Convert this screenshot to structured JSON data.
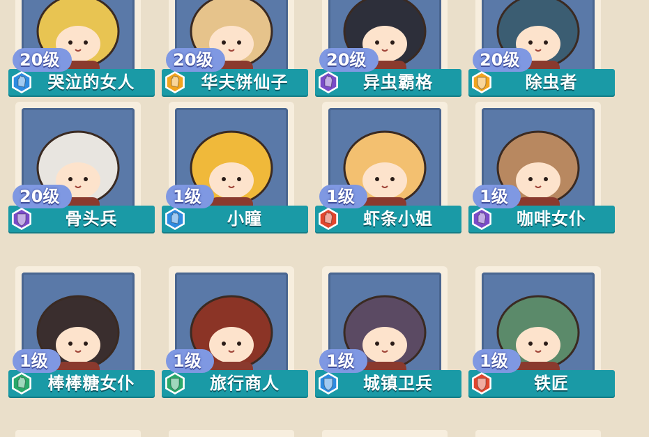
{
  "colors": {
    "background": "#eadfca",
    "card": "#f7eede",
    "portrait_bg": "#5a79a8",
    "namebar": "#1a9aa6",
    "level_bubble": "#7f98e2",
    "rarity": {
      "blue": "#2f8be0",
      "orange": "#f2a51f",
      "purple": "#7a4cc8",
      "red": "#e1462e",
      "green": "#2aa86a"
    }
  },
  "cards": [
    {
      "level": "20级",
      "name": "哭泣的女人",
      "rarity": "blue",
      "icon": "hand-icon",
      "art": "#e8c452"
    },
    {
      "level": "20级",
      "name": "华夫饼仙子",
      "rarity": "orange",
      "icon": "hand-icon",
      "art": "#e6c38b"
    },
    {
      "level": "20级",
      "name": "异虫霸格",
      "rarity": "purple",
      "icon": "hand-icon",
      "art": "#2d2f3a"
    },
    {
      "level": "20级",
      "name": "除虫者",
      "rarity": "orange",
      "icon": "shield-icon",
      "art": "#3b5d72"
    },
    {
      "level": "20级",
      "name": "骨头兵",
      "rarity": "purple",
      "icon": "shield-icon",
      "art": "#e8e5e0"
    },
    {
      "level": "1级",
      "name": "小瞳",
      "rarity": "blue",
      "icon": "hand-icon",
      "art": "#f0b93a"
    },
    {
      "level": "1级",
      "name": "虾条小姐",
      "rarity": "red",
      "icon": "hand-icon",
      "art": "#f3c070"
    },
    {
      "level": "1级",
      "name": "咖啡女仆",
      "rarity": "purple",
      "icon": "hand-icon",
      "art": "#b88860"
    },
    {
      "level": "1级",
      "name": "棒棒糖女仆",
      "rarity": "green",
      "icon": "hand-icon",
      "art": "#3a2e2e"
    },
    {
      "level": "1级",
      "name": "旅行商人",
      "rarity": "green",
      "icon": "shield-icon",
      "art": "#8b3426"
    },
    {
      "level": "1级",
      "name": "城镇卫兵",
      "rarity": "blue",
      "icon": "shield-icon",
      "art": "#5b4a63"
    },
    {
      "level": "1级",
      "name": "铁匠",
      "rarity": "red",
      "icon": "shield-icon",
      "art": "#5b8a6a"
    }
  ]
}
